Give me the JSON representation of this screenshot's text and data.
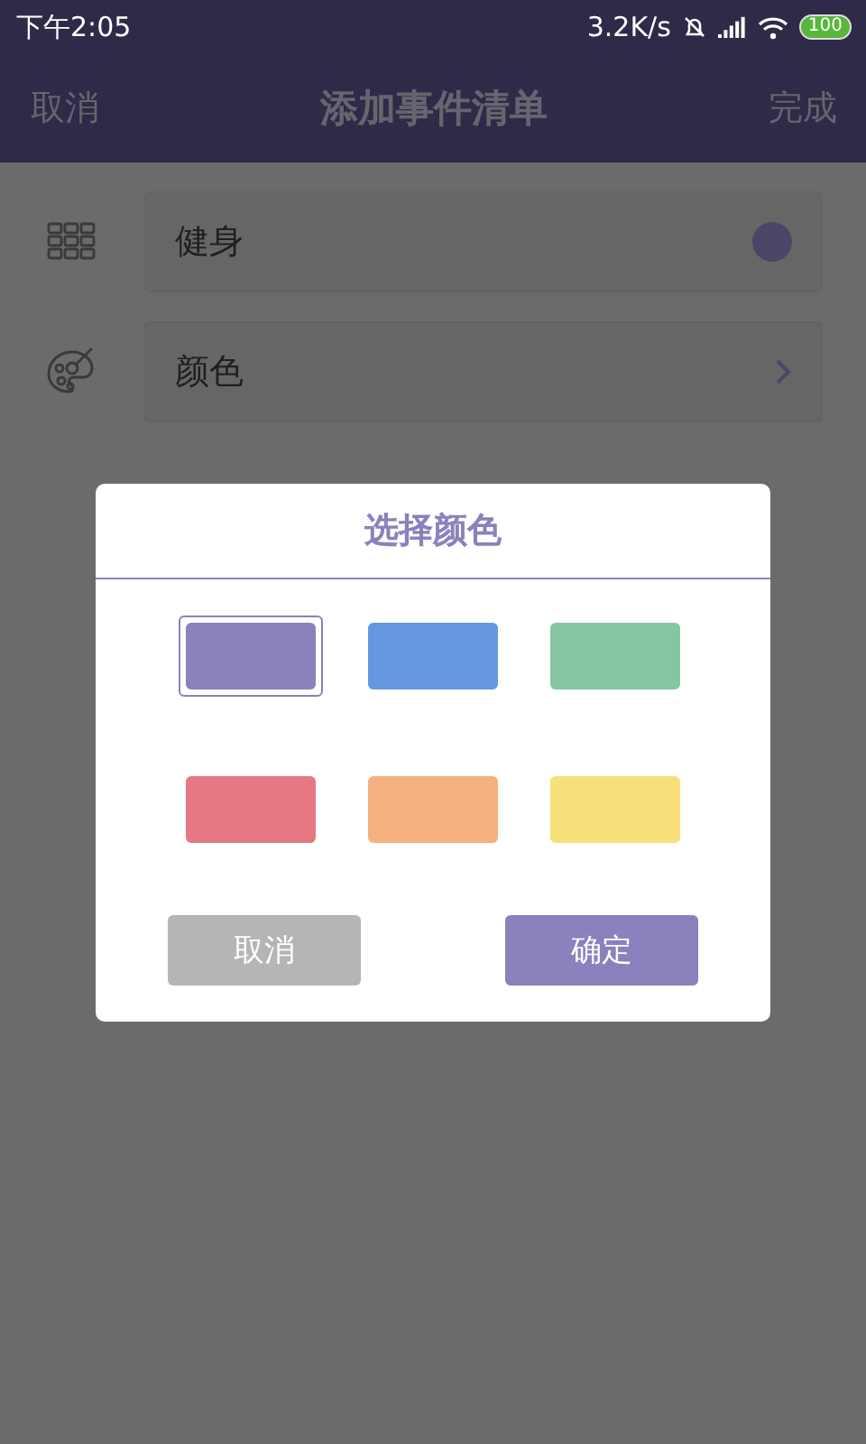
{
  "status_bar": {
    "time": "下午2:05",
    "net_speed": "3.2K/s",
    "battery": "100"
  },
  "header": {
    "cancel": "取消",
    "title": "添加事件清单",
    "done": "完成"
  },
  "fields": [
    {
      "kind": "name",
      "value": "健身",
      "color": "#4a4668"
    },
    {
      "kind": "color",
      "label": "颜色"
    }
  ],
  "dialog": {
    "title": "选择颜色",
    "swatches": [
      {
        "color": "#8c80bd",
        "selected": true
      },
      {
        "color": "#6498e0",
        "selected": false
      },
      {
        "color": "#84c6a2",
        "selected": false
      },
      {
        "color": "#e57882",
        "selected": false
      },
      {
        "color": "#f5b07f",
        "selected": false
      },
      {
        "color": "#f7e07a",
        "selected": false
      }
    ],
    "cancel": "取消",
    "confirm": "确定"
  }
}
